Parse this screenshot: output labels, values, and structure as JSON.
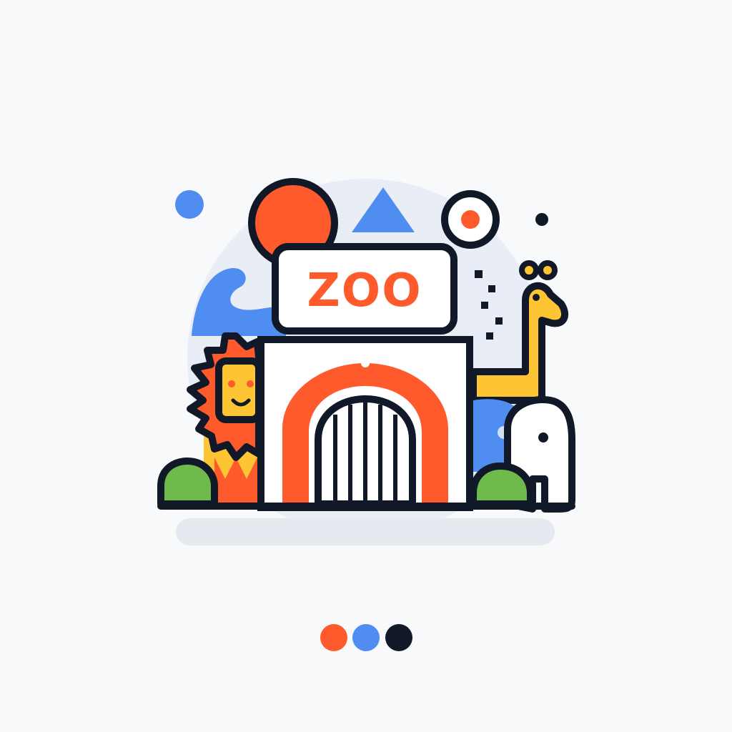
{
  "sign": {
    "text": "ZOO"
  },
  "colors": {
    "background": "#f8f9fb",
    "outline": "#111827",
    "orange": "#ff5a2b",
    "blue": "#4f8ef0",
    "yellow": "#fdc533",
    "green": "#6fba4c",
    "halo": "#e9edf5",
    "shadow": "#e6e9ef",
    "white": "#ffffff"
  },
  "icons": {
    "lion": "lion-icon",
    "giraffe": "giraffe-icon",
    "elephant": "elephant-icon",
    "whale": "whale-tail-icon",
    "gate": "gate-icon",
    "sign": "zoo-sign-icon"
  },
  "indicator_dots": [
    "#ff5a2b",
    "#4f8ef0",
    "#111827"
  ]
}
